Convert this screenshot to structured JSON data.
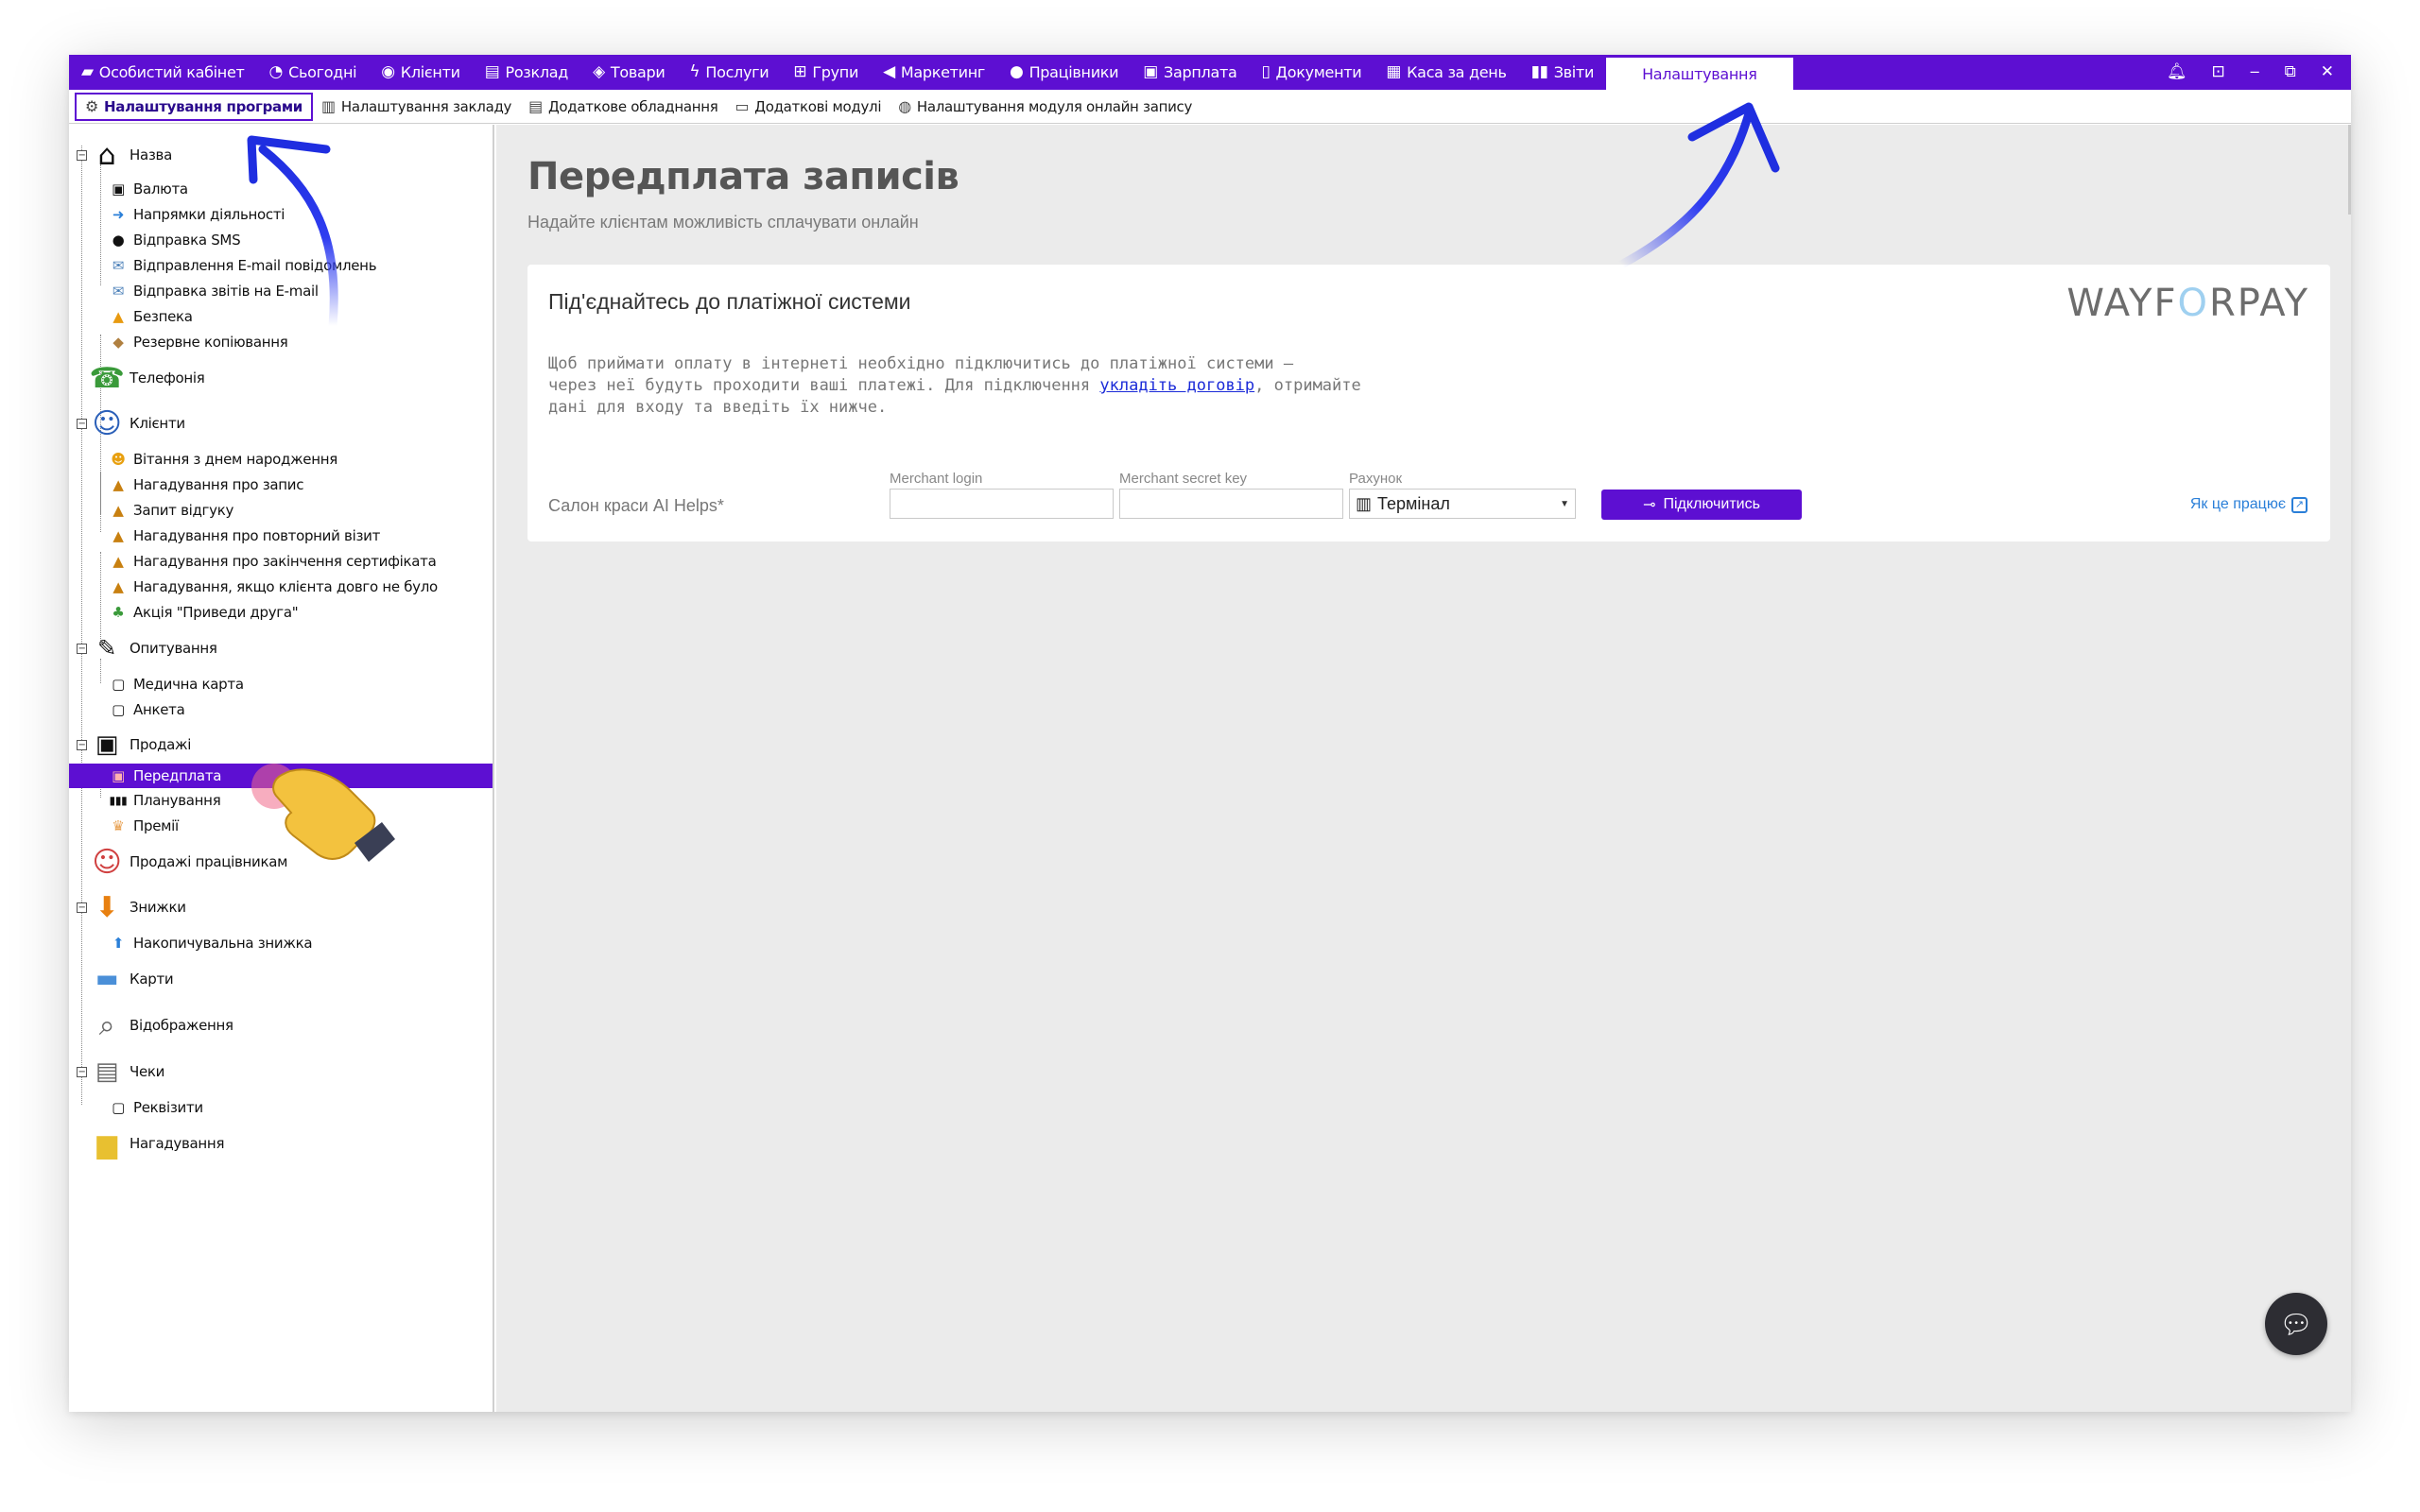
{
  "menubar": {
    "items": [
      {
        "label": "Особистий кабінет",
        "icon": "briefcase-icon"
      },
      {
        "label": "Сьогодні",
        "icon": "clock-icon"
      },
      {
        "label": "Клієнти",
        "icon": "user-circle-icon"
      },
      {
        "label": "Розклад",
        "icon": "calendar-icon"
      },
      {
        "label": "Товари",
        "icon": "cube-icon"
      },
      {
        "label": "Послуги",
        "icon": "lightning-icon"
      },
      {
        "label": "Групи",
        "icon": "group-icon"
      },
      {
        "label": "Маркетинг",
        "icon": "megaphone-icon"
      },
      {
        "label": "Працівники",
        "icon": "person-icon"
      },
      {
        "label": "Зарплата",
        "icon": "money-icon"
      },
      {
        "label": "Документи",
        "icon": "document-icon"
      },
      {
        "label": "Каса за день",
        "icon": "calculator-icon"
      },
      {
        "label": "Звіти",
        "icon": "bar-chart-icon"
      },
      {
        "label": "Налаштування",
        "icon": "",
        "active": true
      }
    ],
    "accent_color": "#5d0fd2"
  },
  "tabs": [
    {
      "label": "Налаштування програми",
      "icon": "gear-icon",
      "active": true
    },
    {
      "label": "Налаштування закладу",
      "icon": "building-icon"
    },
    {
      "label": "Додаткове обладнання",
      "icon": "printer-icon"
    },
    {
      "label": "Додаткові модулі",
      "icon": "window-icon"
    },
    {
      "label": "Налаштування модуля онлайн запису",
      "icon": "globe-icon"
    }
  ],
  "tree": [
    {
      "label": "Назва",
      "level": 0,
      "icon": "house-icon",
      "expander": "−"
    },
    {
      "label": "Валюта",
      "level": 1,
      "icon": "cash-icon"
    },
    {
      "label": "Напрямки діяльності",
      "level": 1,
      "icon": "arrow-right-icon"
    },
    {
      "label": "Відправка SMS",
      "level": 1,
      "icon": "speech-bubble-icon"
    },
    {
      "label": "Відправлення E-mail повідомлень",
      "level": 1,
      "icon": "email-icon"
    },
    {
      "label": "Відправка звітів на E-mail",
      "level": 1,
      "icon": "email-report-icon"
    },
    {
      "label": "Безпека",
      "level": 1,
      "icon": "warning-icon"
    },
    {
      "label": "Резервне копіювання",
      "level": 1,
      "icon": "backup-icon"
    },
    {
      "label": "Телефонія",
      "level": 0,
      "icon": "telephony-icon"
    },
    {
      "label": "Клієнти",
      "level": 0,
      "icon": "client-icon",
      "expander": "−"
    },
    {
      "label": "Вітання з днем народження",
      "level": 1,
      "icon": "smiley-icon"
    },
    {
      "label": "Нагадування про запис",
      "level": 1,
      "icon": "bell-icon"
    },
    {
      "label": "Запит відгуку",
      "level": 1,
      "icon": "bell-icon"
    },
    {
      "label": "Нагадування про повторний візит",
      "level": 1,
      "icon": "bell-icon"
    },
    {
      "label": "Нагадування про закінчення сертифіката",
      "level": 1,
      "icon": "bell-icon"
    },
    {
      "label": "Нагадування, якщо клієнта довго не було",
      "level": 1,
      "icon": "bell-icon"
    },
    {
      "label": "Акція \"Приведи друга\"",
      "level": 1,
      "icon": "friends-icon"
    },
    {
      "label": "Опитування",
      "level": 0,
      "icon": "survey-icon",
      "expander": "−"
    },
    {
      "label": "Медична карта",
      "level": 1,
      "icon": "form-icon"
    },
    {
      "label": "Анкета",
      "level": 1,
      "icon": "form-icon"
    },
    {
      "label": "Продажі",
      "level": 0,
      "icon": "banknote-icon",
      "expander": "−"
    },
    {
      "label": "Передплата",
      "level": 1,
      "icon": "prepayment-icon",
      "selected": true
    },
    {
      "label": "Планування",
      "level": 1,
      "icon": "bars-icon"
    },
    {
      "label": "Премії",
      "level": 1,
      "icon": "trophy-icon"
    },
    {
      "label": "Продажі працівникам",
      "level": 0,
      "icon": "employee-sales-icon"
    },
    {
      "label": "Знижки",
      "level": 0,
      "icon": "discount-arrow-icon",
      "expander": "−"
    },
    {
      "label": "Накопичувальна знижка",
      "level": 1,
      "icon": "arrow-up-icon"
    },
    {
      "label": "Карти",
      "level": 0,
      "icon": "card-icon"
    },
    {
      "label": "Відображення",
      "level": 0,
      "icon": "magnifier-icon"
    },
    {
      "label": "Чеки",
      "level": 0,
      "icon": "receipt-printer-icon",
      "expander": "−"
    },
    {
      "label": "Реквізити",
      "level": 1,
      "icon": "form-icon"
    },
    {
      "label": "Нагадування",
      "level": 0,
      "icon": "note-icon"
    }
  ],
  "main": {
    "title": "Передплата записів",
    "subtitle": "Надайте клієнтам можливість сплачувати онлайн",
    "card": {
      "title": "Під'єднайтесь до платіжної системи",
      "brand_left": "WAYF",
      "brand_o": "O",
      "brand_right": "RPAY",
      "desc_line1": "Щоб приймати оплату в інтернеті необхідно підключитись до платіжної системи —",
      "desc_line2a": "через неї будуть проходити ваші платежі. Для підключення ",
      "desc_link": "укладіть договір",
      "desc_line2b": ", отримайте",
      "desc_line3": "дані для входу та введіть їх нижче.",
      "salon_name": "Салон краси AI Helps*",
      "merchant_login_label": "Merchant login",
      "merchant_login_value": "",
      "merchant_secret_label": "Merchant secret key",
      "merchant_secret_value": "",
      "account_label": "Рахунок",
      "account_value": "Термінал",
      "connect_label": "Підключитись",
      "how_link": "Як це працює"
    }
  }
}
